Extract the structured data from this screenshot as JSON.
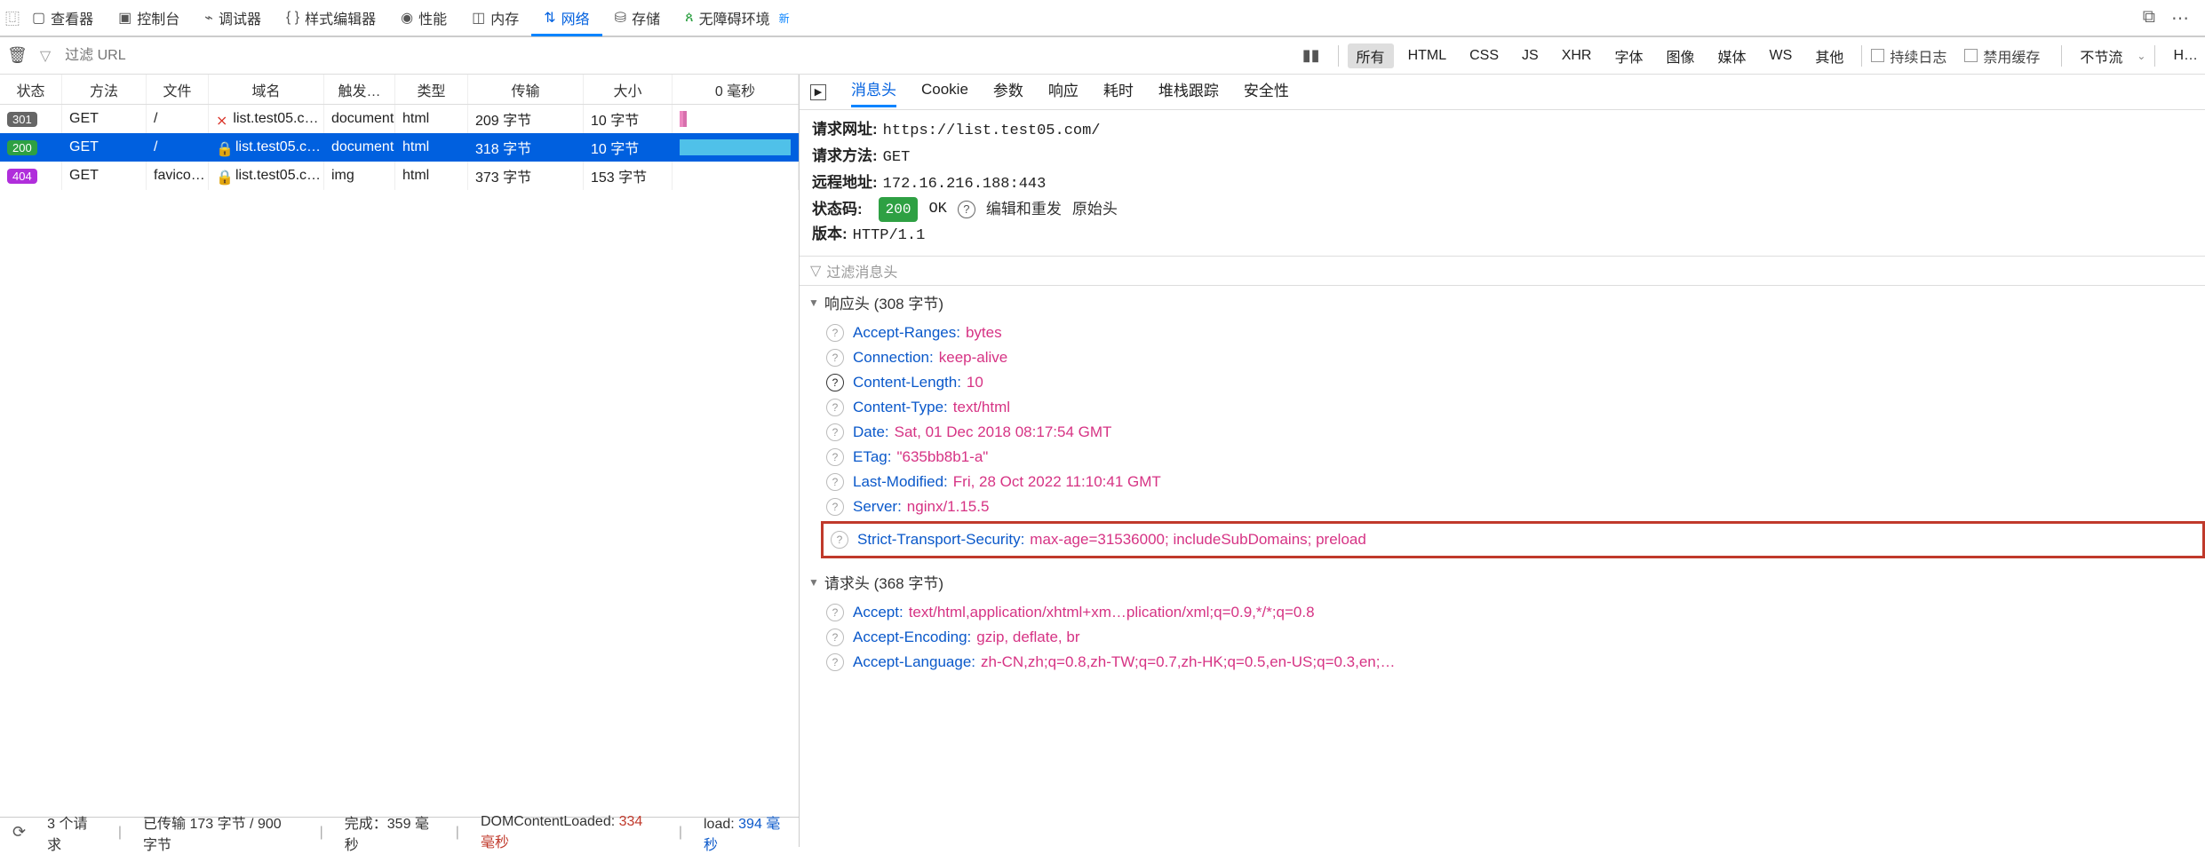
{
  "tabs": {
    "inspector": "查看器",
    "console": "控制台",
    "debugger": "调试器",
    "style": "样式编辑器",
    "perf": "性能",
    "memory": "内存",
    "network": "网络",
    "storage": "存储",
    "a11y": "无障碍环境",
    "new": "新"
  },
  "toolbar": {
    "filter_placeholder": "过滤 URL",
    "filters": {
      "all": "所有",
      "html": "HTML",
      "css": "CSS",
      "js": "JS",
      "xhr": "XHR",
      "fonts": "字体",
      "images": "图像",
      "media": "媒体",
      "ws": "WS",
      "other": "其他"
    },
    "persist": "持续日志",
    "nocache": "禁用缓存",
    "throttle": "不节流",
    "har": "H…"
  },
  "table": {
    "headers": {
      "status": "状态",
      "method": "方法",
      "file": "文件",
      "domain": "域名",
      "cause": "触发…",
      "type": "类型",
      "transfer": "传输",
      "size": "大小",
      "time": "0 毫秒"
    },
    "rows": [
      {
        "status": "301",
        "scls": "b301",
        "method": "GET",
        "file": "/",
        "lock": "red",
        "domain": "list.test05.c…",
        "cause": "document",
        "type": "html",
        "xfer": "209 字节",
        "size": "10 字节",
        "wf": [
          [
            "#ec87c0",
            3
          ],
          [
            "#d770ad",
            3
          ]
        ]
      },
      {
        "status": "200",
        "scls": "b200",
        "method": "GET",
        "file": "/",
        "lock": "green",
        "domain": "list.test05.c…",
        "cause": "document",
        "type": "html",
        "xfer": "318 字节",
        "size": "10 字节",
        "sel": true,
        "wf": [
          [
            "#4fc1e9",
            100
          ]
        ]
      },
      {
        "status": "404",
        "scls": "b404",
        "method": "GET",
        "file": "favico…",
        "lock": "green",
        "domain": "list.test05.c…",
        "cause": "img",
        "type": "html",
        "xfer": "373 字节",
        "size": "153 字节",
        "wf": []
      }
    ]
  },
  "detail": {
    "tabs": {
      "headers": "消息头",
      "cookie": "Cookie",
      "params": "参数",
      "response": "响应",
      "timings": "耗时",
      "stack": "堆栈跟踪",
      "security": "安全性"
    },
    "summary": {
      "url_l": "请求网址:",
      "url": "https://list.test05.com/",
      "method_l": "请求方法:",
      "method": "GET",
      "remote_l": "远程地址:",
      "remote": "172.16.216.188:443",
      "status_l": "状态码:",
      "status_code": "200",
      "status_text": "OK",
      "edit": "编辑和重发",
      "raw": "原始头",
      "version_l": "版本:",
      "version": "HTTP/1.1"
    },
    "filter_placeholder": "过滤消息头",
    "resp_title": "响应头 (308 字节)",
    "resp": [
      {
        "n": "Accept-Ranges:",
        "v": "bytes"
      },
      {
        "n": "Connection:",
        "v": "keep-alive"
      },
      {
        "n": "Content-Length:",
        "v": "10",
        "dark": true
      },
      {
        "n": "Content-Type:",
        "v": "text/html"
      },
      {
        "n": "Date:",
        "v": "Sat, 01 Dec 2018 08:17:54 GMT"
      },
      {
        "n": "ETag:",
        "v": "\"635bb8b1-a\""
      },
      {
        "n": "Last-Modified:",
        "v": "Fri, 28 Oct 2022 11:10:41 GMT"
      },
      {
        "n": "Server:",
        "v": "nginx/1.15.5"
      },
      {
        "n": "Strict-Transport-Security:",
        "v": "max-age=31536000; includeSubDomains; preload",
        "hl": true
      }
    ],
    "req_title": "请求头 (368 字节)",
    "req": [
      {
        "n": "Accept:",
        "v": "text/html,application/xhtml+xm…plication/xml;q=0.9,*/*;q=0.8"
      },
      {
        "n": "Accept-Encoding:",
        "v": "gzip, deflate, br"
      },
      {
        "n": "Accept-Language:",
        "v": "zh-CN,zh;q=0.8,zh-TW;q=0.7,zh-HK;q=0.5,en-US;q=0.3,en;…"
      }
    ]
  },
  "status": {
    "n": "3 个请求",
    "xfer": "已传输 173 字节 / 900 字节",
    "finish": "完成：359 毫秒",
    "dcl_l": "DOMContentLoaded:",
    "dcl": "334 毫秒",
    "load_l": "load:",
    "load": "394 毫秒"
  }
}
